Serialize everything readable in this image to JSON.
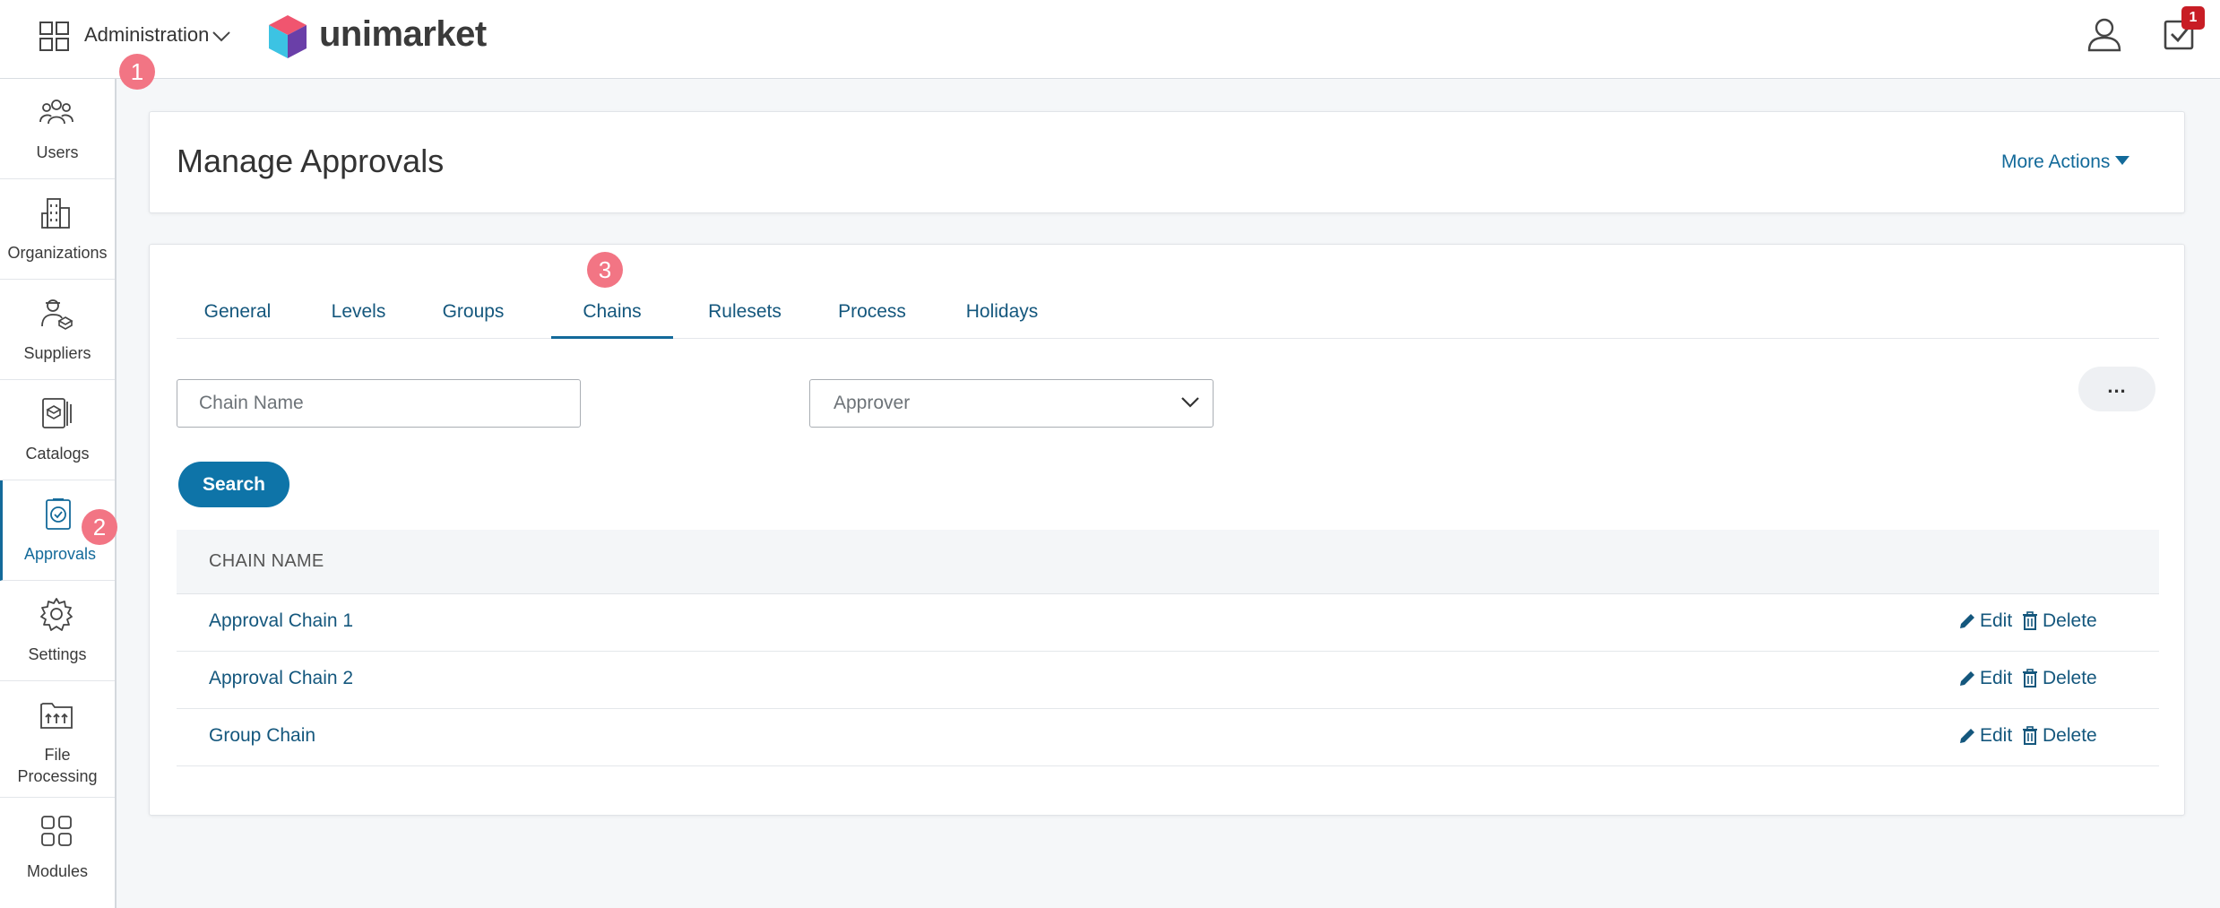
{
  "header": {
    "module_label": "Administration",
    "brand_name": "unimarket",
    "tasks_badge": "1"
  },
  "markers": [
    "1",
    "2",
    "3"
  ],
  "sidebar": {
    "items": [
      {
        "label": "Users",
        "icon": "users-icon"
      },
      {
        "label": "Organizations",
        "icon": "building-icon"
      },
      {
        "label": "Suppliers",
        "icon": "supplier-icon"
      },
      {
        "label": "Catalogs",
        "icon": "catalog-icon"
      },
      {
        "label": "Approvals",
        "icon": "approval-icon",
        "active": true
      },
      {
        "label": "Settings",
        "icon": "gear-icon"
      },
      {
        "label": "File\nProcessing",
        "icon": "file-processing-icon"
      },
      {
        "label": "Modules",
        "icon": "modules-icon"
      }
    ]
  },
  "page": {
    "title": "Manage Approvals",
    "more_actions": "More Actions"
  },
  "tabs": [
    "General",
    "Levels",
    "Groups",
    "Chains",
    "Rulesets",
    "Process",
    "Holidays"
  ],
  "active_tab": "Chains",
  "filters": {
    "chain_name_placeholder": "Chain Name",
    "approver_placeholder": "Approver",
    "more_label": "...",
    "search_label": "Search"
  },
  "table": {
    "column": "CHAIN NAME",
    "rows": [
      "Approval Chain 1",
      "Approval Chain 2",
      "Group Chain"
    ],
    "edit_label": "Edit",
    "delete_label": "Delete"
  },
  "colors": {
    "accent": "#136a9a",
    "primary_button": "#0e74a8",
    "marker": "#f27584",
    "badge": "#c81d25"
  }
}
